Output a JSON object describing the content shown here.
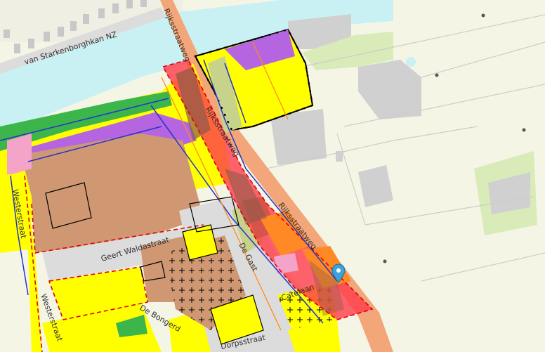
{
  "map": {
    "streets": {
      "starkenborgh": "van Starkenborghkan NZ",
      "rijksstraatweg_north": "Rijksstraatweg",
      "rijksstraatweg_mid": "Rijksstraatweg",
      "rijksstraatweg_east": "Rijksstraatweg",
      "westerstraat_a": "Westerstraat",
      "westerstraat_b": "Westerstraat",
      "geert_waldastraat": "Geert Waldastraat",
      "de_bongerd": "De Bongerd",
      "de_gast": "De Gast",
      "catelaan": "Catelaan",
      "dorpsstraat": "Dorpsstraat"
    },
    "marker": "location-pin",
    "colors": {
      "water": "#c9f1f3",
      "meadow": "#f5f5e6",
      "building_gray": "#d0d0d0",
      "residential_yellow": "#ffff00",
      "commercial_purple": "#b565e0",
      "industrial_brown": "#cf9873",
      "green_zone": "#3cb54a",
      "mixed_olive": "#c7d38a",
      "highlight_red": "#ff3c4a",
      "orange_zone": "#ff8a25",
      "pink_zone": "#f4a4c8",
      "road_orange": "#f2a679",
      "boundary_red": "#e00000",
      "pin_blue": "#3ea3d8"
    }
  }
}
